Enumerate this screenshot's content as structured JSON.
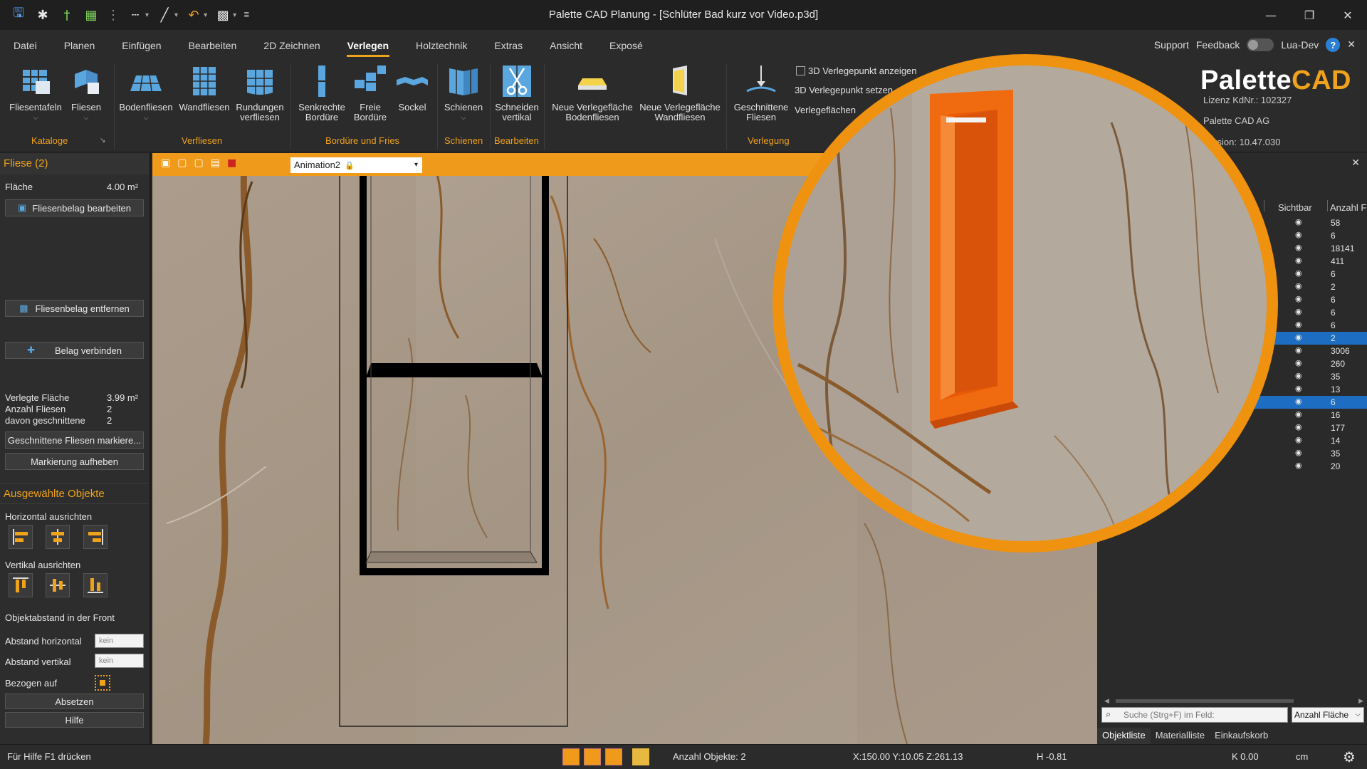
{
  "app": {
    "title": "Palette CAD Planung - [Schlüter Bad kurz vor Video.p3d]"
  },
  "quick_access": {
    "icons": [
      "save-icon",
      "settings-wand-icon",
      "pin-icon",
      "grid-icon",
      "dots-icon",
      "dashed-line-icon",
      "measure-icon",
      "undo-icon",
      "view-icon",
      "more-icon"
    ]
  },
  "menu": {
    "tabs": [
      "Datei",
      "Planen",
      "Einfügen",
      "Bearbeiten",
      "2D Zeichnen",
      "Verlegen",
      "Holztechnik",
      "Extras",
      "Ansicht",
      "Exposé"
    ],
    "active": "Verlegen",
    "support": "Support",
    "feedback": "Feedback",
    "lua_dev": "Lua-Dev"
  },
  "ribbon": {
    "fliesentafeln": "Fliesentafeln",
    "fliesen": "Fliesen",
    "bodenfliesen": "Bodenfliesen",
    "wandfliesen": "Wandfliesen",
    "rundungen": "Rundungen verfliesen",
    "senkrechte": "Senkrechte Bordüre",
    "freie": "Freie Bordüre",
    "sockel": "Sockel",
    "schienen": "Schienen",
    "schneiden": "Schneiden vertikal",
    "neue_boden": "Neue Verlegefläche Bodenfliesen",
    "neue_wand": "Neue Verlegefläche Wandfliesen",
    "geschnittene": "Geschnittene Fliesen",
    "check_3d": "3D Verlegepunkt anzeigen",
    "set_3d": "3D Verlegepunkt setzen",
    "verlegeflaechen": "Verlegeflächen",
    "groups": {
      "kataloge": "Kataloge",
      "verfliesen": "Verfliesen",
      "bordure": "Bordüre und Fries",
      "schienen": "Schienen",
      "bearbeiten": "Bearbeiten",
      "verlegung": "Verlegung"
    },
    "brand": {
      "logo_a": "Palette",
      "logo_b": "CAD",
      "license": "Lizenz KdNr.: 102327",
      "company": "Palette CAD AG",
      "version": "Version: 10.47.030"
    }
  },
  "left_panel": {
    "header": "Fliese (2)",
    "flaeche_label": "Fläche",
    "flaeche_value": "4.00 m²",
    "edit_btn": "Fliesenbelag bearbeiten",
    "remove_btn": "Fliesenbelag entfernen",
    "connect_btn": "Belag verbinden",
    "verlegte_label": "Verlegte Fläche",
    "verlegte_value": "3.99 m²",
    "anzahl_label": "Anzahl Fliesen",
    "anzahl_value": "2",
    "davon_label": "davon geschnittene",
    "davon_value": "2",
    "mark_btn": "Geschnittene Fliesen markiere...",
    "unmark_btn": "Markierung aufheben",
    "section2": "Ausgewählte Objekte",
    "horiz": "Horizontal ausrichten",
    "vert": "Vertikal ausrichten",
    "objabstand": "Objektabstand in der Front",
    "abst_h_label": "Abstand horizontal",
    "abst_h_value": "kein",
    "abst_v_label": "Abstand vertikal",
    "abst_v_value": "kein",
    "bezogen": "Bezogen auf",
    "absetzen": "Absetzen",
    "hilfe": "Hilfe"
  },
  "viewport": {
    "animation": "Animation2"
  },
  "right_panel": {
    "col_sichtbar": "Sichtbar",
    "col_anzahl": "Anzahl F",
    "rows": [
      "58",
      "6",
      "18141",
      "411",
      "6",
      "2",
      "6",
      "6",
      "6",
      "2",
      "3006",
      "260",
      "35",
      "13",
      "6",
      "16",
      "177",
      "14",
      "35",
      "20"
    ],
    "selected_rows": [
      9,
      14
    ],
    "search_placeholder": "Suche (Strg+F) im Feld:",
    "field_select": "Anzahl Fläche",
    "tabs": [
      "Objektliste",
      "Materialliste",
      "Einkaufskorb"
    ]
  },
  "status": {
    "help": "Für Hilfe F1 drücken",
    "count": "Anzahl Objekte: 2",
    "coords": "X:150.00  Y:10.05  Z:261.13",
    "h": "H -0.81",
    "k": "K 0.00",
    "unit": "cm"
  },
  "colors": {
    "accent": "#f0a21b",
    "selection": "#1d6ec2",
    "niche": "#f06a10"
  }
}
